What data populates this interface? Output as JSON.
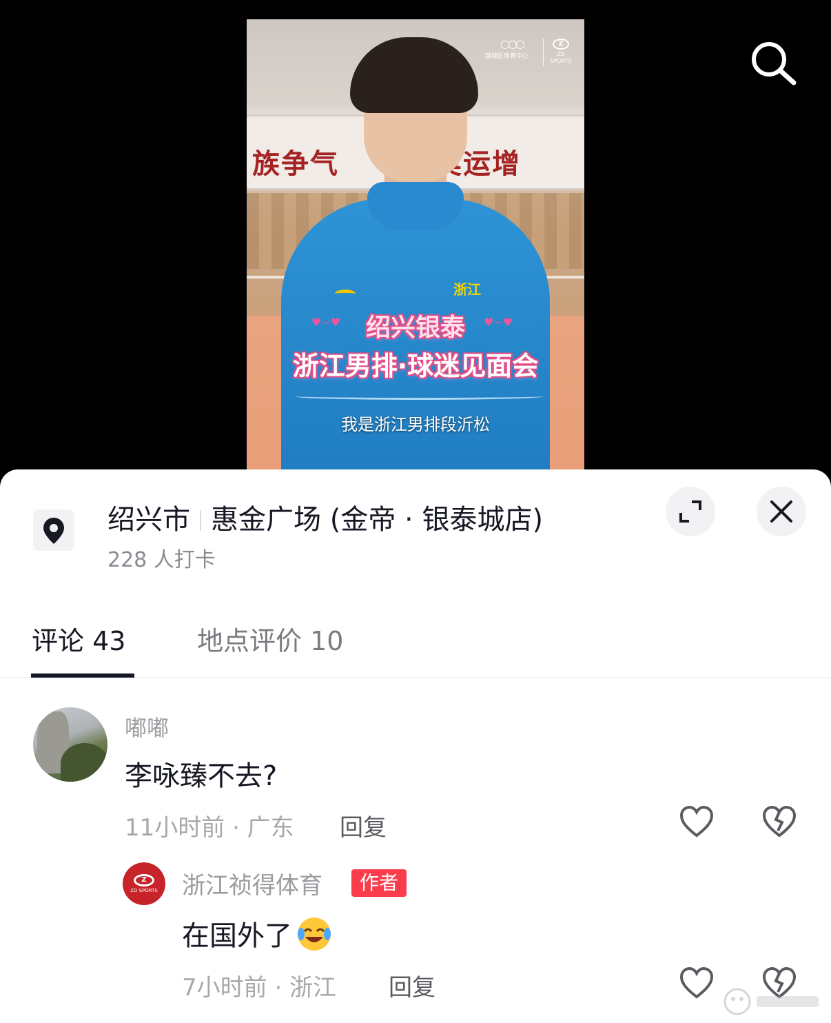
{
  "video": {
    "banner_left": "族争气",
    "banner_right": "奥运增",
    "logo_org": "越城区体育中心",
    "logo_brand": "ZD SPORTS",
    "jersey_text": "浙江",
    "title_line1": "绍兴银泰",
    "title_line2": "浙江男排·球迷见面会",
    "subtitle": "我是浙江男排段沂松"
  },
  "location": {
    "city": "绍兴市",
    "name": "惠金广场 (金帝 · 银泰城店)",
    "checkins": "228 人打卡",
    "icon": "location-pin-icon"
  },
  "tabs": [
    {
      "label": "评论 43",
      "active": true
    },
    {
      "label": "地点评价 10",
      "active": false
    }
  ],
  "comment": {
    "user": "嘟嘟",
    "text": "李咏臻不去?",
    "meta": "11小时前 · 广东",
    "reply_label": "回复"
  },
  "reply": {
    "user": "浙江祯得体育",
    "badge": "作者",
    "text": "在国外了",
    "meta": "7小时前 · 浙江",
    "reply_label": "回复",
    "avatar_brand": "ZD SPORTS"
  },
  "icons": {
    "search": "search-icon",
    "expand": "expand-icon",
    "close": "close-icon",
    "like": "heart-icon",
    "dislike": "broken-heart-icon"
  },
  "colors": {
    "accent_red": "#fa3c4c",
    "text_primary": "#161823",
    "text_secondary": "#a7a8ab"
  }
}
